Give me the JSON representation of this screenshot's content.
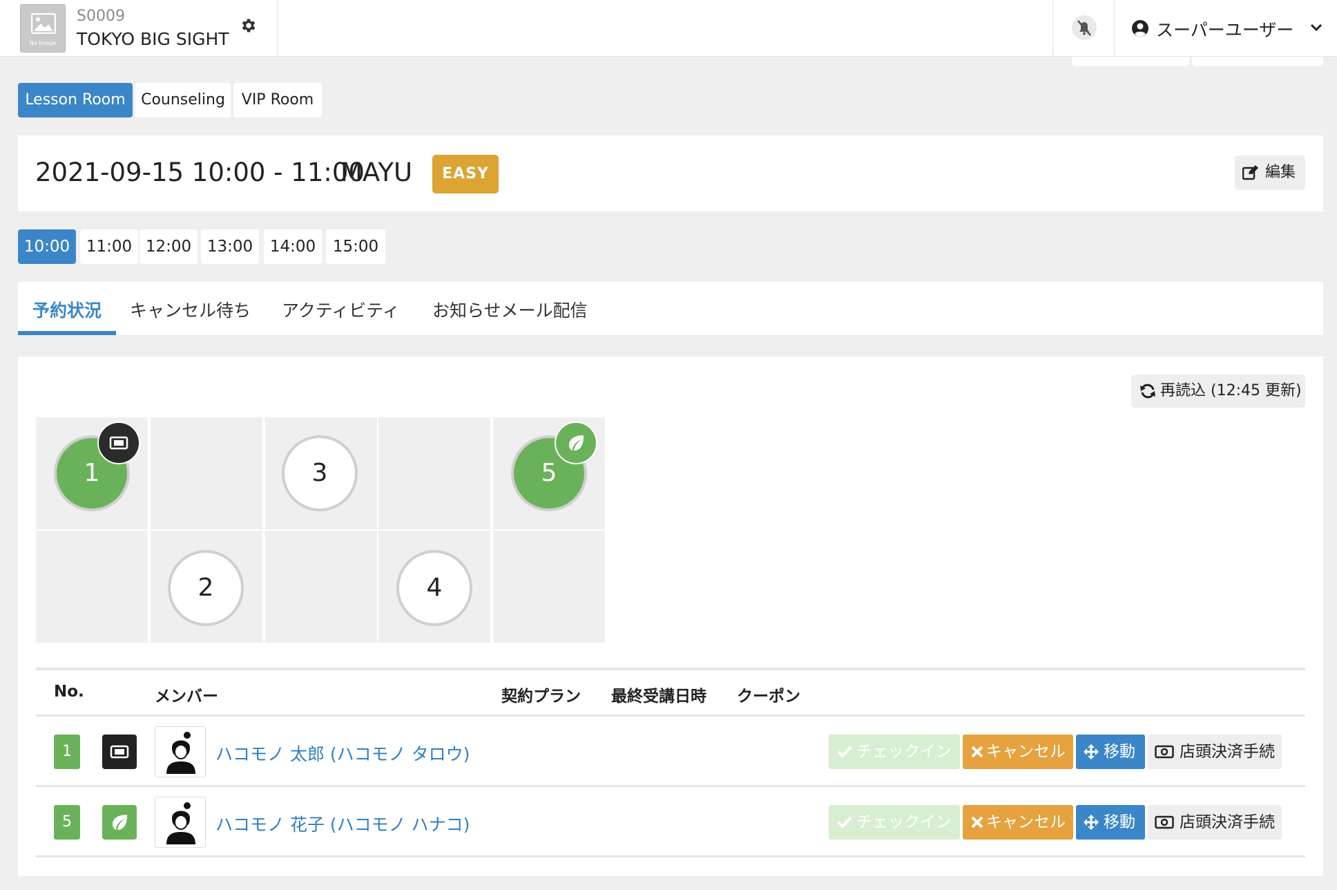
{
  "header": {
    "store_code": "S0009",
    "store_name": "TOKYO BIG SIGHT",
    "no_image_caption": "No Image",
    "user_name": "スーパーユーザー"
  },
  "room_tabs": [
    {
      "label": "Lesson Room",
      "active": true
    },
    {
      "label": "Counseling",
      "active": false
    },
    {
      "label": "VIP Room",
      "active": false
    }
  ],
  "session": {
    "datetime": "2021-09-15 10:00 - 11:00",
    "trainer": "MAYU",
    "level": "EASY",
    "edit_label": "編集"
  },
  "time_tabs": [
    "10:00",
    "11:00",
    "12:00",
    "13:00",
    "14:00",
    "15:00"
  ],
  "active_time": "10:00",
  "section_tabs": [
    {
      "label": "予約状況",
      "active": true
    },
    {
      "label": "キャンセル待ち",
      "active": false
    },
    {
      "label": "アクティビティ",
      "active": false
    },
    {
      "label": "お知らせメール配信",
      "active": false
    }
  ],
  "reload_label": "再読込 (12:45 更新)",
  "spots": [
    {
      "number": "1",
      "taken": true,
      "badge": "ticket-icon"
    },
    {
      "number": "2",
      "taken": false,
      "badge": ""
    },
    {
      "number": "3",
      "taken": false,
      "badge": ""
    },
    {
      "number": "4",
      "taken": false,
      "badge": ""
    },
    {
      "number": "5",
      "taken": true,
      "badge": "leaf-icon"
    }
  ],
  "table": {
    "headers": {
      "no": "No.",
      "member": "メンバー",
      "plan": "契約プラン",
      "last_lesson": "最終受講日時",
      "coupon": "クーポン"
    },
    "rows": [
      {
        "no": "1",
        "type_icon": "ticket-icon",
        "member": "ハコモノ 太郎 (ハコモノ タロウ)"
      },
      {
        "no": "5",
        "type_icon": "leaf-icon",
        "member": "ハコモノ 花子 (ハコモノ ハナコ)"
      }
    ],
    "actions": {
      "checkin": "チェックイン",
      "cancel": "キャンセル",
      "move": "移動",
      "pay": "店頭決済手続"
    }
  },
  "colors": {
    "primary": "#3a86c9",
    "taken": "#6ab25a",
    "level_badge": "#dba433",
    "cancel": "#e6a23e",
    "checkin_disabled": "#d8eed2",
    "link": "#2f7fc4"
  }
}
